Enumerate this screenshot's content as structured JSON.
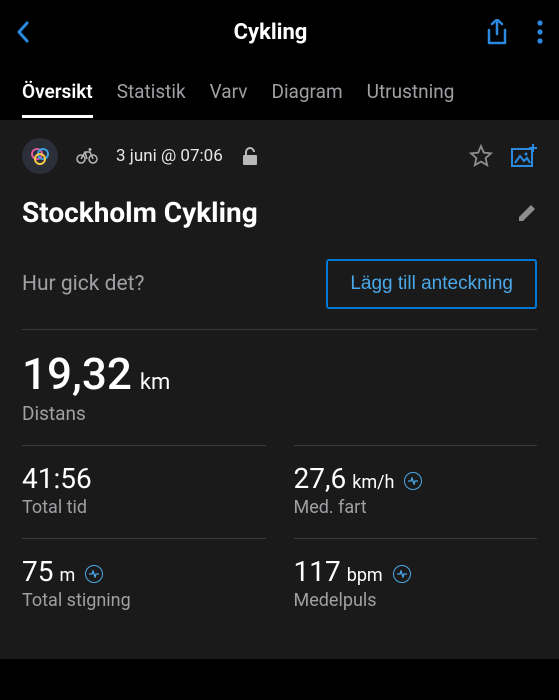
{
  "header": {
    "title": "Cykling"
  },
  "tabs": [
    {
      "label": "Översikt",
      "active": true
    },
    {
      "label": "Statistik",
      "active": false
    },
    {
      "label": "Varv",
      "active": false
    },
    {
      "label": "Diagram",
      "active": false
    },
    {
      "label": "Utrustning",
      "active": false
    }
  ],
  "meta": {
    "date": "3 juni @ 07:06"
  },
  "activity": {
    "title": "Stockholm Cykling"
  },
  "note": {
    "prompt": "Hur gick det?",
    "button": "Lägg till anteckning"
  },
  "hero": {
    "value": "19,32",
    "unit": "km",
    "label": "Distans"
  },
  "stats": [
    {
      "value": "41:56",
      "unit": "",
      "label": "Total tid",
      "badge": false
    },
    {
      "value": "27,6",
      "unit": "km/h",
      "label": "Med. fart",
      "badge": true
    },
    {
      "value": "75",
      "unit": "m",
      "label": "Total stigning",
      "badge": true
    },
    {
      "value": "117",
      "unit": "bpm",
      "label": "Medelpuls",
      "badge": true
    }
  ]
}
